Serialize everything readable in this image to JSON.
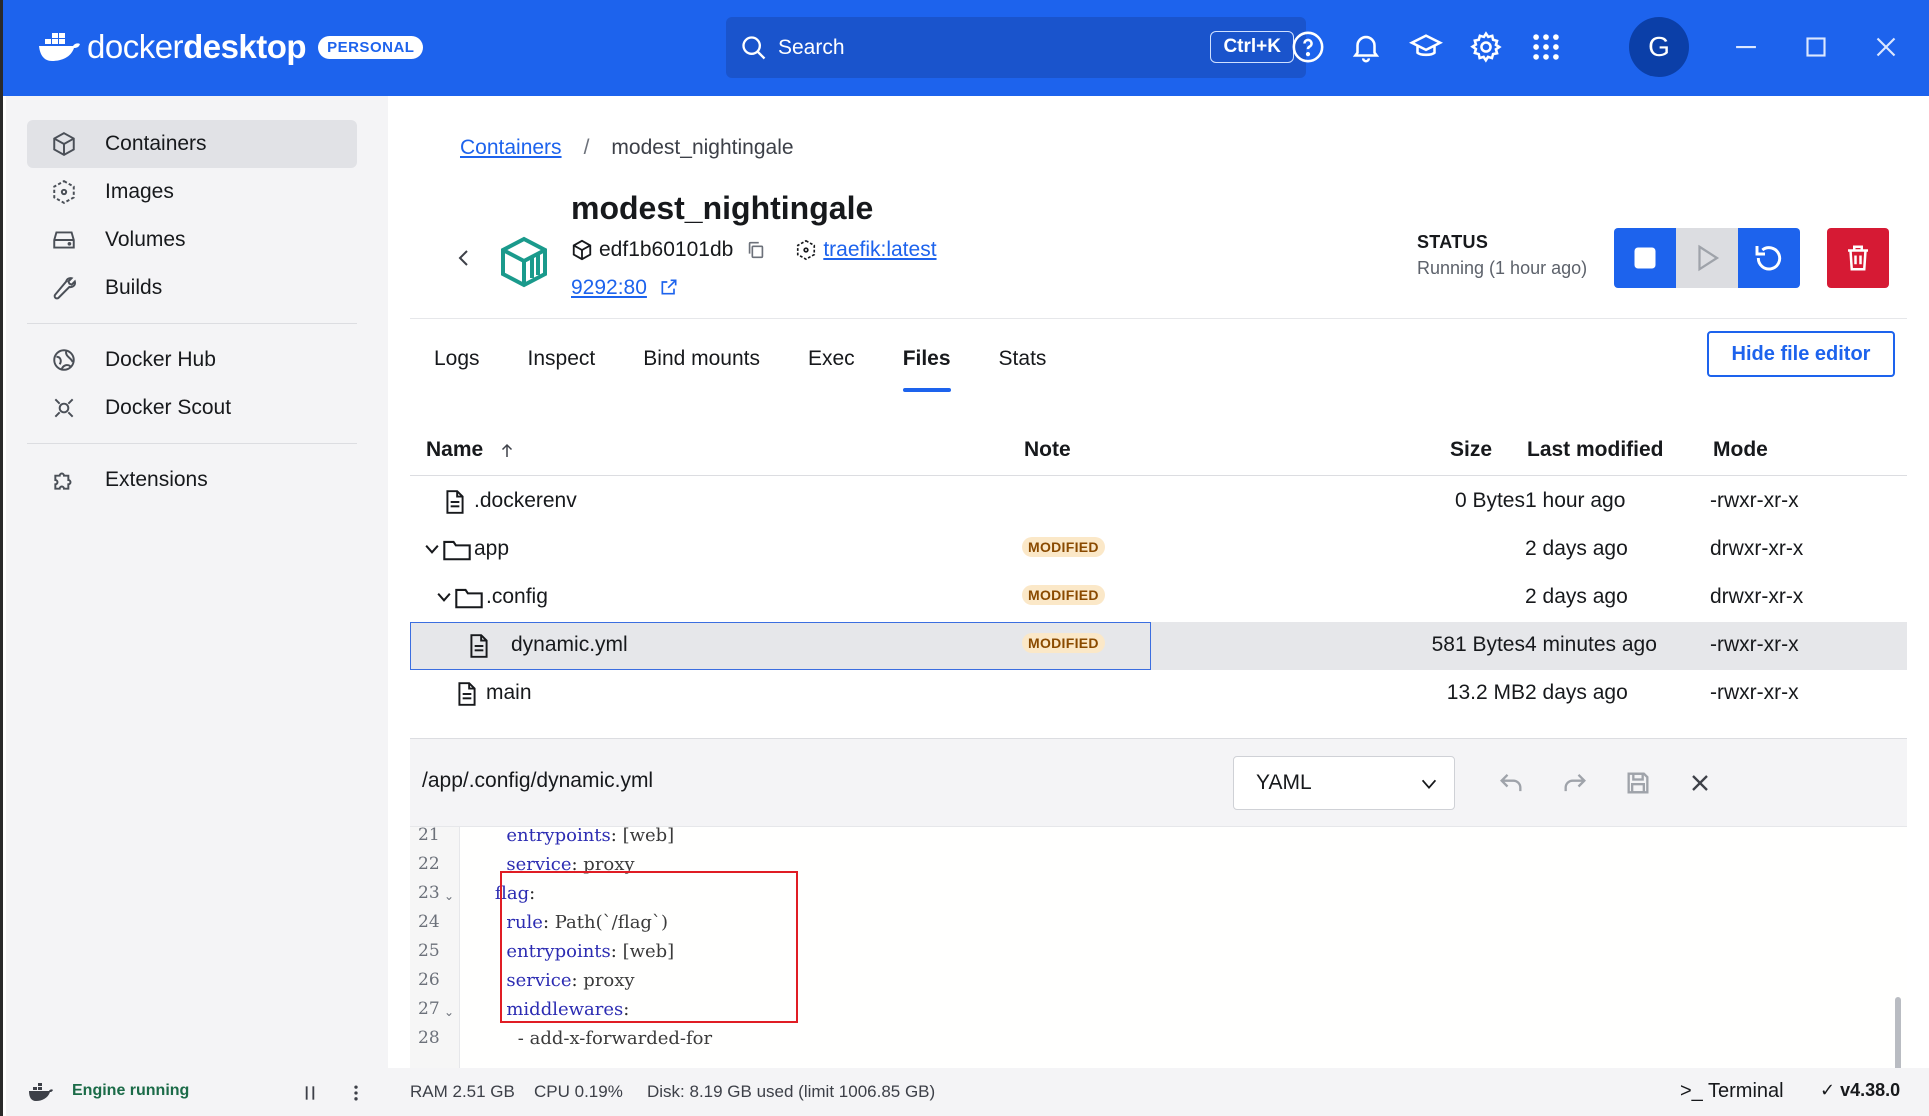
{
  "titlebar": {
    "brand_word_light": "docker",
    "brand_word_bold": "desktop",
    "plan_badge": "PERSONAL",
    "search_label": "Search",
    "search_shortcut": "Ctrl+K",
    "avatar_letter": "G",
    "bg_color": "#1d63ed"
  },
  "sidebar": {
    "items": [
      {
        "label": "Containers",
        "icon": "containers-icon",
        "active": true
      },
      {
        "label": "Images",
        "icon": "images-icon"
      },
      {
        "label": "Volumes",
        "icon": "volumes-icon"
      },
      {
        "label": "Builds",
        "icon": "builds-icon"
      },
      {
        "label": "Docker Hub",
        "icon": "docker-hub-icon"
      },
      {
        "label": "Docker Scout",
        "icon": "docker-scout-icon"
      },
      {
        "label": "Extensions",
        "icon": "extensions-icon"
      }
    ]
  },
  "breadcrumb": {
    "parent": "Containers",
    "separator": "/",
    "current": "modest_nightingale"
  },
  "container": {
    "name": "modest_nightingale",
    "id": "edf1b60101db",
    "image": "traefik:latest",
    "port": "9292:80",
    "status_label": "STATUS",
    "status_value": "Running (1 hour ago)"
  },
  "tabs": [
    "Logs",
    "Inspect",
    "Bind mounts",
    "Exec",
    "Files",
    "Stats"
  ],
  "active_tab": "Files",
  "hide_editor_label": "Hide file editor",
  "files_table": {
    "columns": [
      "Name",
      "Note",
      "Size",
      "Last modified",
      "Mode"
    ],
    "rows": [
      {
        "name": ".dockerenv",
        "note": "",
        "size": "0 Bytes",
        "modified": "1 hour ago",
        "mode": "-rwxr-xr-x"
      },
      {
        "name": "app",
        "note": "MODIFIED",
        "size": "",
        "modified": "2 days ago",
        "mode": "drwxr-xr-x"
      },
      {
        "name": ".config",
        "note": "MODIFIED",
        "size": "",
        "modified": "2 days ago",
        "mode": "drwxr-xr-x"
      },
      {
        "name": "dynamic.yml",
        "note": "MODIFIED",
        "size": "581 Bytes",
        "modified": "4 minutes ago",
        "mode": "-rwxr-xr-x"
      },
      {
        "name": "main",
        "note": "",
        "size": "13.2 MB",
        "modified": "2 days ago",
        "mode": "-rwxr-xr-x"
      }
    ]
  },
  "editor": {
    "path": "/app/.config/dynamic.yml",
    "language": "YAML",
    "lines": [
      {
        "n": "21",
        "key": "entrypoints",
        "val": "[web]"
      },
      {
        "n": "22",
        "key": "service",
        "val": "proxy"
      },
      {
        "n": "23",
        "key": "flag",
        "val": ""
      },
      {
        "n": "24",
        "key": "rule",
        "val": "Path(`/flag`)"
      },
      {
        "n": "25",
        "key": "entrypoints",
        "val": "[web]"
      },
      {
        "n": "26",
        "key": "service",
        "val": "proxy"
      },
      {
        "n": "27",
        "key": "middlewares",
        "val": ""
      },
      {
        "n": "28",
        "key": "",
        "val": "- add-x-forwarded-for"
      }
    ]
  },
  "footer": {
    "engine": "Engine running",
    "ram": "RAM 2.51 GB",
    "cpu": "CPU 0.19%",
    "disk": "Disk: 8.19 GB used (limit 1006.85 GB)",
    "terminal": "Terminal",
    "version": "v4.38.0"
  }
}
